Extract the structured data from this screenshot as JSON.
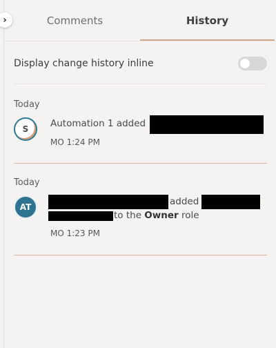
{
  "tabs": [
    {
      "label": "Comments",
      "active": false
    },
    {
      "label": "History",
      "active": true
    }
  ],
  "settings": {
    "inline_label": "Display change history inline",
    "inline_enabled": false
  },
  "history": [
    {
      "day": "Today",
      "avatar_initials": "S",
      "actor": "Automation 1",
      "action": "added",
      "time": "MO 1:24 PM"
    },
    {
      "day": "Today",
      "avatar_initials": "AT",
      "action": "added",
      "role_prefix": "to the",
      "role_name": "Owner",
      "role_suffix": "role",
      "time": "MO 1:23 PM"
    }
  ],
  "colors": {
    "accent": "#cfa98d",
    "avatar_blue": "#2e7490",
    "background": "#f5f3f1"
  }
}
